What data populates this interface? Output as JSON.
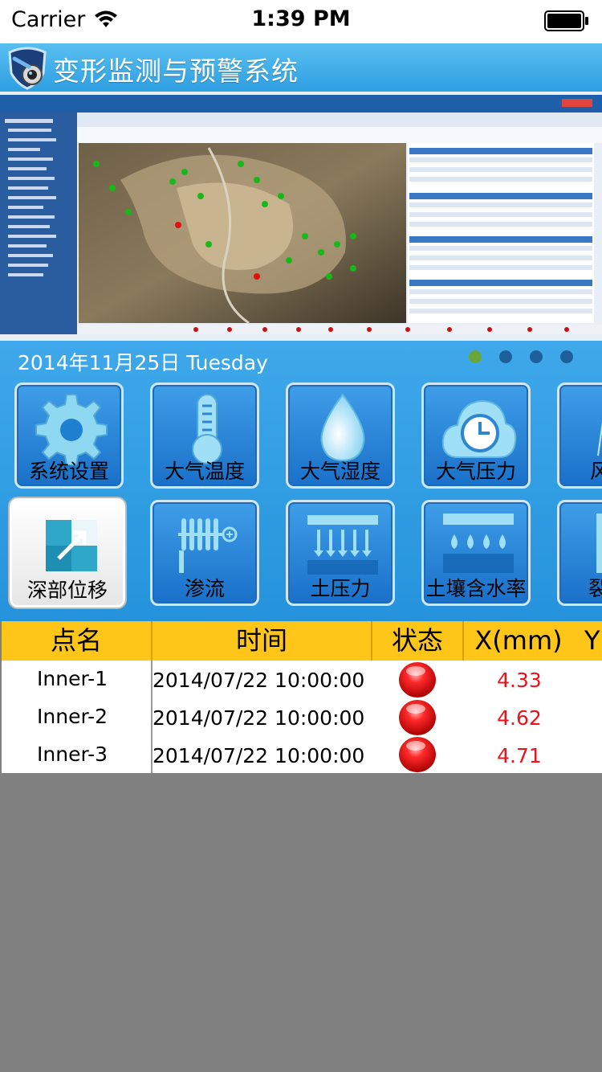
{
  "status_bar": {
    "carrier": "Carrier",
    "time": "1:39 PM"
  },
  "header": {
    "title": "变形监测与预警系统"
  },
  "dashboard": {
    "date": "2014年11月25日 Tuesday",
    "page_count": 4,
    "active_page": 1,
    "tiles": [
      {
        "label": "系统设置",
        "icon": "gear-icon"
      },
      {
        "label": "大气温度",
        "icon": "thermometer-icon"
      },
      {
        "label": "大气湿度",
        "icon": "water-drop-icon"
      },
      {
        "label": "大气压力",
        "icon": "clock-cloud-icon"
      },
      {
        "label": "风",
        "icon": "wind-icon"
      },
      {
        "label": "深部位移",
        "icon": "displacement-icon"
      },
      {
        "label": "渗流",
        "icon": "seepage-icon"
      },
      {
        "label": "土压力",
        "icon": "soil-pressure-icon"
      },
      {
        "label": "土壤含水率",
        "icon": "soil-moisture-icon"
      },
      {
        "label": "裂",
        "icon": "crack-icon"
      }
    ]
  },
  "table": {
    "headers": [
      "点名",
      "时间",
      "状态",
      "X(mm)",
      "Y"
    ],
    "rows": [
      {
        "name": "Inner-1",
        "time": "2014/07/22 10:00:00",
        "status": "alarm",
        "x": "4.33"
      },
      {
        "name": "Inner-2",
        "time": "2014/07/22 10:00:00",
        "status": "alarm",
        "x": "4.62"
      },
      {
        "name": "Inner-3",
        "time": "2014/07/22 10:00:00",
        "status": "alarm",
        "x": "4.71"
      }
    ]
  },
  "colors": {
    "header_blue": "#2e9fe2",
    "table_header": "#ffc61a",
    "value_red": "#e8141b",
    "status_red": "#e00000"
  }
}
